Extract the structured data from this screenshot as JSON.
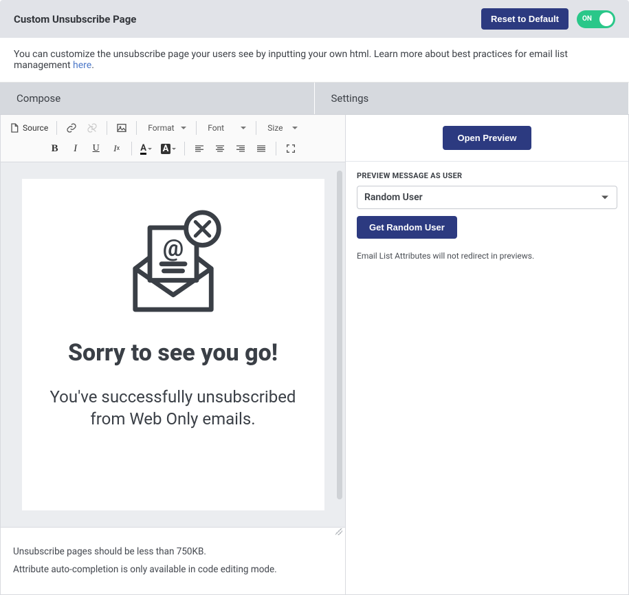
{
  "header": {
    "title": "Custom Unsubscribe Page",
    "reset_label": "Reset to Default",
    "toggle_label": "ON"
  },
  "info": {
    "text_prefix": "You can customize the unsubscribe page your users see by inputting your own html. Learn more about best practices for email list management ",
    "link_text": "here",
    "text_suffix": "."
  },
  "tabs": {
    "compose": "Compose",
    "settings": "Settings"
  },
  "toolbar": {
    "source": "Source",
    "format": "Format",
    "font": "Font",
    "size": "Size"
  },
  "canvas": {
    "heading": "Sorry to see you go!",
    "subtext": "You've successfully unsubscribed from Web Only emails."
  },
  "footer": {
    "note1": "Unsubscribe pages should be less than 750KB.",
    "note2": "Attribute auto-completion is only available in code editing mode."
  },
  "right": {
    "open_preview": "Open Preview",
    "preview_label": "PREVIEW MESSAGE AS USER",
    "user_select_value": "Random User",
    "get_random_user": "Get Random User",
    "note": "Email List Attributes will not redirect in previews."
  }
}
